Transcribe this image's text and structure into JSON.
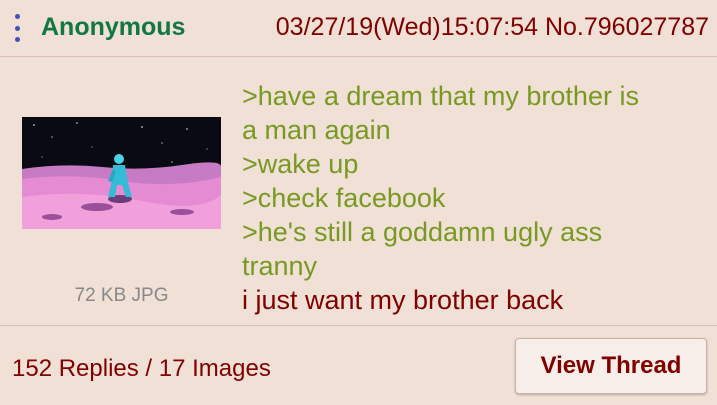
{
  "post": {
    "name": "Anonymous",
    "datetime": "03/27/19(Wed)15:07:54 No.796027787",
    "file_info": "72 KB JPG",
    "comment_lines": [
      {
        "text": ">have a dream that my brother is",
        "quote": true
      },
      {
        "text": "a man again",
        "quote": true
      },
      {
        "text": ">wake up",
        "quote": true
      },
      {
        "text": ">check facebook",
        "quote": true
      },
      {
        "text": ">he's still a goddamn ugly ass",
        "quote": true
      },
      {
        "text": "tranny",
        "quote": true
      },
      {
        "text": "i just want my brother back",
        "quote": false
      }
    ]
  },
  "footer": {
    "replies": "152 Replies / 17 Images",
    "view_thread_label": "View Thread"
  },
  "icons": {
    "menu": "more-vert-icon",
    "thumbnail": "thumbnail-image"
  },
  "colors": {
    "background": "#f0e0d6",
    "name": "#117743",
    "maroon": "#800000",
    "greentext": "#789922",
    "menu_dots": "#3f51b5",
    "muted": "#888888"
  }
}
